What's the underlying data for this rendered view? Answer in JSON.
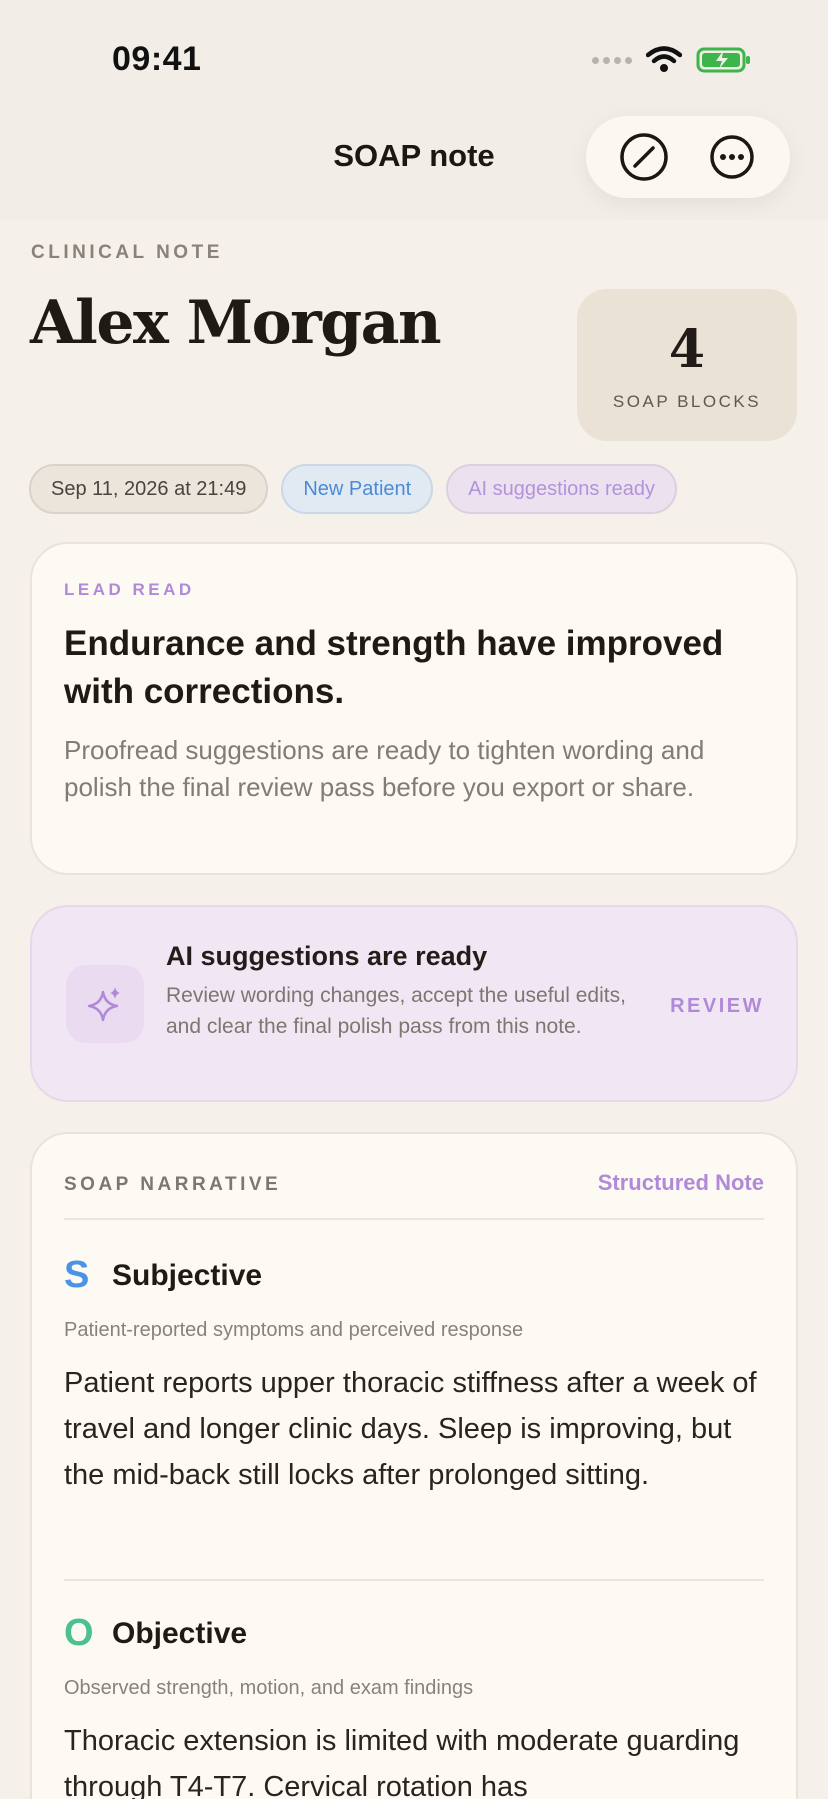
{
  "status": {
    "time": "09:41"
  },
  "nav": {
    "title": "SOAP note"
  },
  "header": {
    "eyebrow": "CLINICAL NOTE",
    "patient_name": "Alex Morgan",
    "count": "4",
    "count_label": "SOAP BLOCKS"
  },
  "chips": {
    "date": "Sep 11, 2026 at 21:49",
    "new_patient": "New Patient",
    "ai_ready": "AI suggestions ready"
  },
  "lead": {
    "eyebrow": "LEAD READ",
    "title": "Endurance and strength have improved with corrections.",
    "body": "Proofread suggestions are ready to tighten wording and polish the final review pass before you export or share."
  },
  "ai_banner": {
    "title": "AI suggestions are ready",
    "body": "Review wording changes, accept the useful edits, and clear the final polish pass from this note.",
    "action": "REVIEW"
  },
  "soap": {
    "eyebrow": "SOAP NARRATIVE",
    "tag": "Structured Note",
    "sections": [
      {
        "letter": "S",
        "title": "Subjective",
        "subtitle": "Patient-reported symptoms and perceived response",
        "body": "Patient reports upper thoracic stiffness after a week of travel and longer clinic days. Sleep is improving, but the mid-back still locks after prolonged sitting.",
        "color": "#4a93e6"
      },
      {
        "letter": "O",
        "title": "Objective",
        "subtitle": "Observed strength, motion, and exam findings",
        "body": "Thoracic extension is limited with moderate guarding through T4-T7. Cervical rotation has",
        "color": "#4cc08e"
      }
    ]
  },
  "colors": {
    "accent_purple": "#b08ad8",
    "background": "#f5f0e9"
  }
}
